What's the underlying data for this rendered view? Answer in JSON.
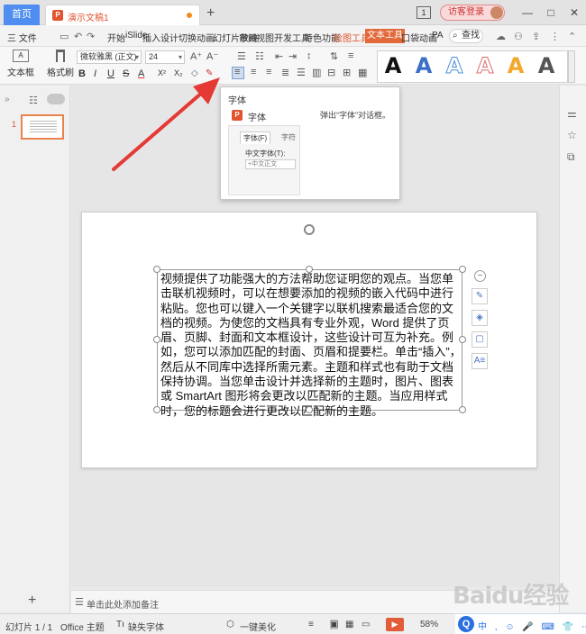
{
  "titlebar": {
    "home_tab": "首页",
    "doc_tab": "演示文稿1",
    "badge": "1",
    "login": "访客登录",
    "win_min": "—",
    "win_max": "□",
    "win_close": "✕"
  },
  "menu": {
    "file": "三 文件",
    "items": [
      "开始",
      "iSlide",
      "插入",
      "设计",
      "切换",
      "动画",
      "幻灯片放映",
      "审阅",
      "视图",
      "开发工具",
      "特色功能",
      "绘图工具",
      "文本工具",
      "口袋动画",
      "PA"
    ],
    "active": "文本工具",
    "highlight": "绘图工具",
    "search": "查找"
  },
  "ribbon": {
    "textbox_label": "文本框",
    "brush_label": "格式刷",
    "font_name": "微软雅黑 (正文)",
    "font_size": "24",
    "bold": "B",
    "italic": "I",
    "underline": "U",
    "strike": "S",
    "shadow": "A",
    "superscript": "X²",
    "subscript": "X₂",
    "grow": "A⁺",
    "shrink": "A⁻",
    "style_letters": [
      "A",
      "A",
      "A",
      "A",
      "A",
      "A"
    ]
  },
  "tooltip": {
    "title": "字体",
    "row_label": "字体",
    "desc": "弹出“字体”对话框。",
    "preview_tab1": "字体(F)",
    "preview_tab2": "字符",
    "preview_cn": "中文字体(T):",
    "preview_input": "+中文正文"
  },
  "leftpane": {
    "slide_number": "1"
  },
  "slide": {
    "text": "视频提供了功能强大的方法帮助您证明您的观点。当您单击联机视频时，可以在想要添加的视频的嵌入代码中进行粘贴。您也可以键入一个关键字以联机搜索最适合您的文档的视频。为使您的文档具有专业外观，Word 提供了页眉、页脚、封面和文本框设计，这些设计可互为补充。例如，您可以添加匹配的封面、页眉和提要栏。单击“插入”，然后从不同库中选择所需元素。主题和样式也有助于文档保持协调。当您单击设计并选择新的主题时，图片、图表或 SmartArt 图形将会更改以匹配新的主题。当应用样式时，您的标题会进行更改以匹配新的主题。"
  },
  "notes": {
    "placeholder": "单击此处添加备注"
  },
  "status": {
    "slide_count": "幻灯片 1 / 1",
    "theme": "Office 主题",
    "missing_font": "缺失字体",
    "beautify": "一键美化",
    "zoom": "58%",
    "ime_row": "中 , ☺ 🎤 ⌨ 👕 ⋯"
  },
  "watermark": "Baidu经验",
  "colors": {
    "accent": "#e2542f",
    "home_tab": "#4f8ef0",
    "arrow": "#e53935"
  }
}
